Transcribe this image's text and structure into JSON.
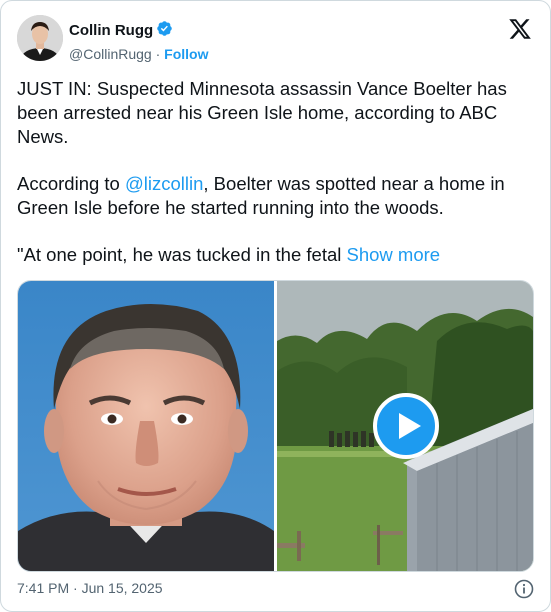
{
  "author": {
    "name": "Collin Rugg",
    "handle": "@CollinRugg",
    "separator": "·",
    "follow_label": "Follow"
  },
  "tweet": {
    "p1": "JUST IN: Suspected Minnesota assassin Vance Boelter has been arrested near his Green Isle home, according to ABC News.",
    "p2_before": "According to ",
    "p2_mention": "@lizcollin",
    "p2_after": ", Boelter was spotted near a home in Green Isle before he started running into the woods.",
    "p3": "\"At one point, he was tucked in the fetal ",
    "show_more": "Show more"
  },
  "footer": {
    "timestamp": "7:41 PM · Jun 15, 2025"
  },
  "colors": {
    "accent": "#1d9bf0",
    "secondary_text": "#536471",
    "verified": "#1d9bf0"
  },
  "icons": {
    "verified": "verified-badge-icon",
    "logo": "x-logo-icon",
    "play": "play-icon",
    "info": "info-icon"
  }
}
